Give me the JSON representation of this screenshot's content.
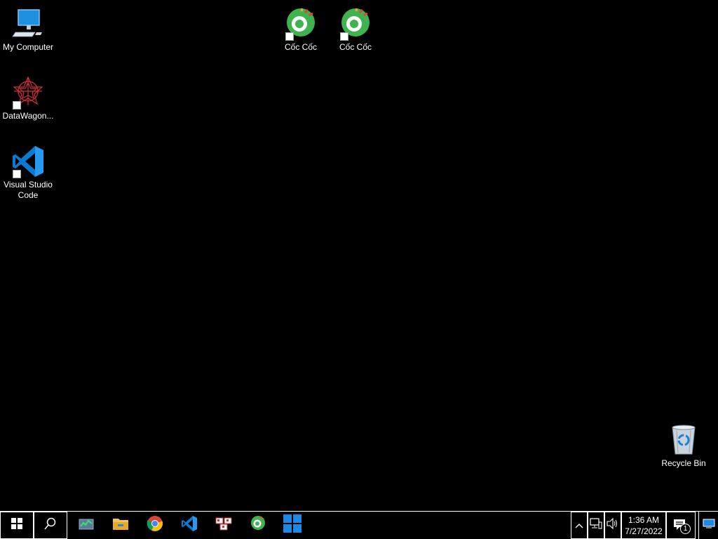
{
  "desktop": {
    "icons": [
      {
        "id": "my-computer",
        "label": "My Computer",
        "icon": "computer-icon"
      },
      {
        "id": "datawagon",
        "label": "DataWagon...",
        "icon": "datawagon-icon"
      },
      {
        "id": "vscode",
        "label": "Visual Studio Code",
        "icon": "vscode-icon"
      },
      {
        "id": "coccoc-1",
        "label": "Cốc Cốc",
        "icon": "coccoc-icon"
      },
      {
        "id": "coccoc-2",
        "label": "Cốc Cốc",
        "icon": "coccoc-icon"
      },
      {
        "id": "recycle-bin",
        "label": "Recycle Bin",
        "icon": "recycle-bin-icon"
      }
    ]
  },
  "taskbar": {
    "start_icon": "windows-start-icon",
    "search_icon": "search-icon",
    "pinned": [
      "task-manager-icon",
      "file-explorer-icon",
      "chrome-icon",
      "vscode-icon",
      "unikey-icon",
      "coccoc-icon",
      "windows-tile-icon"
    ],
    "tray": {
      "clock_time": "1:36 AM",
      "clock_date": "7/27/2022",
      "notification_count": "1"
    }
  },
  "colors": {
    "background": "#000000",
    "coccoc_green": "#3fb34f",
    "vscode_blue": "#0a7bd4",
    "taskbar_border": "#ffffff"
  }
}
